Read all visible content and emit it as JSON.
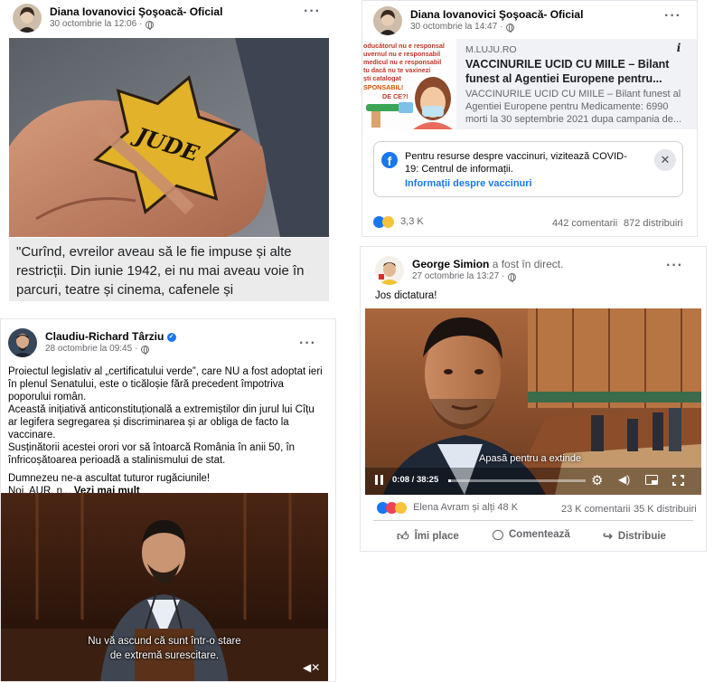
{
  "post1": {
    "author": "Diana Iovanovici Şoşoacă- Oficial",
    "time": "30 octombrie la 12:06",
    "menu_icon": "more-horizontal-icon",
    "star_text": "JUDE",
    "quote": "\"Curînd, evreilor aveau să le fie impuse și alte restricții. Din iunie 1942, ei nu mai aveau voie în parcuri, teatre și cinema, cafenele și"
  },
  "post2": {
    "author": "Diana Iovanovici Şoşoacă- Oficial",
    "time": "30 octombrie la 14:47",
    "link": {
      "domain": "M.LUJU.RO",
      "title": "VACCINURILE UCID CU MIILE – Bilant funest al Agentiei Europene pentru...",
      "description": "VACCINURILE UCID CU MIILE – Bilant funest al Agentiei Europene pentru Medicamente: 6990 morti la 30 septembrie 2021 dupa campania de...",
      "thumb_lines": [
        "oducătorul nu e responsal",
        "uvernul nu e responsabil",
        "medicul nu e responsabil",
        "tu dacă nu te vaxinezi",
        "ști catalogat",
        "SPONSABIL!",
        "DE CE?!"
      ]
    },
    "notice": {
      "text": "Pentru resurse despre vaccinuri, vizitează COVID-19: Centrul de informații.",
      "link": "Informații despre vaccinuri"
    },
    "reactions": "3,3 K",
    "comments": "442 comentarii",
    "shares": "872 distribuiri"
  },
  "post3": {
    "author": "George Simion",
    "suffix": "a fost în direct.",
    "time": "27 octombrie la 13:27",
    "text": "Jos dictatura!",
    "video": {
      "elapsed": "0:08",
      "duration": "38:25",
      "expand_hint": "Apasă pentru a extinde",
      "progress": 0.004
    },
    "reactions_label": "Elena Avram și alți 48 K",
    "comments": "23 K comentarii",
    "shares": "35 K distribuiri",
    "actions": [
      "Îmi place",
      "Comentează",
      "Distribuie"
    ]
  },
  "post4": {
    "author": "Claudiu-Richard Târziu",
    "time": "28 octombrie la 09:45",
    "text": [
      "Proiectul legislativ al „certificatului verde”, care NU a fost adoptat ieri în plenul Senatului, este o ticăloșie fără precedent împotriva poporului român.",
      "Această inițiativă anticonstituțională a extremiștilor din jurul lui Cîțu  ar legifera segregarea și discriminarea și ar obliga de facto la vaccinare.",
      "Susținătorii acestei orori vor să întoarcă România în anii 50, în înfricoșătoarea perioadă a stalinismului de stat.",
      "Dumnezeu ne-a ascultat tuturor rugăciunile!"
    ],
    "last_line": "Noi, AUR, n...",
    "see_more": "Vezi mai mult",
    "subtitle_1": "Nu vă ascund că sunt într-o stare",
    "subtitle_2": "de extremă surescitare."
  },
  "colors": {
    "fb_blue": "#1877f2",
    "text": "#050505",
    "secondary": "#65676b",
    "divider": "#ced0d4",
    "link_title": "#1c1e21"
  }
}
